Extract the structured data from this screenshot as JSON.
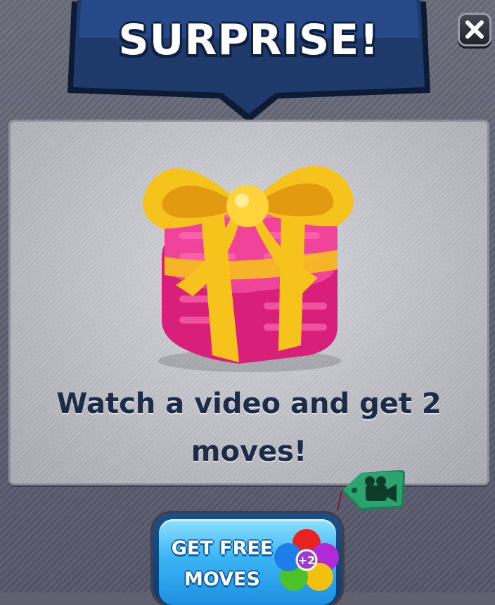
{
  "popup": {
    "title": "SURPRISE!",
    "close_icon": "close-x-icon",
    "message": "Watch a video and get 2 moves!",
    "reward_icon": "gift-box-icon",
    "ad_tag_icon": "video-camera-icon",
    "cta": {
      "label": "GET FREE MOVES",
      "badge": "+2",
      "badge_icon": "colored-orbs-icon"
    }
  },
  "colors": {
    "banner": "#1d3a6b",
    "title_outline": "#0f1f3f",
    "message_text": "#1c2c47",
    "gift_box": "#e8378f",
    "ribbon": "#f6c21c",
    "button": "#3bb5f5",
    "tag": "#2aa36e"
  }
}
